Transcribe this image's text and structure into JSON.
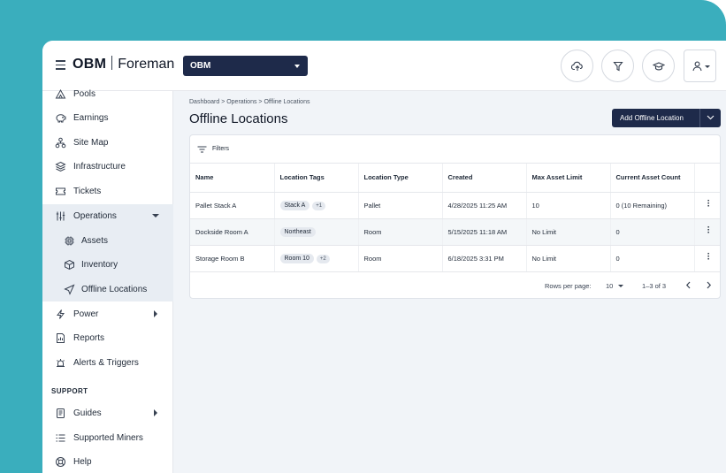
{
  "app": {
    "logo_bold": "OBM",
    "logo_text": "Foreman",
    "org_selector": "OBM"
  },
  "header_icons": [
    "upload-icon",
    "filter-icon",
    "graduation-cap-icon",
    "user-icon"
  ],
  "sidebar": {
    "items": [
      {
        "label": "Pools",
        "icon": "pools-icon"
      },
      {
        "label": "Earnings",
        "icon": "piggy-bank-icon"
      },
      {
        "label": "Site Map",
        "icon": "site-map-icon"
      },
      {
        "label": "Infrastructure",
        "icon": "layers-icon"
      },
      {
        "label": "Tickets",
        "icon": "ticket-icon"
      },
      {
        "label": "Operations",
        "icon": "sliders-icon"
      },
      {
        "label": "Assets",
        "icon": "chip-icon"
      },
      {
        "label": "Inventory",
        "icon": "box-icon"
      },
      {
        "label": "Offline Locations",
        "icon": "location-arrow-icon"
      },
      {
        "label": "Power",
        "icon": "lightning-icon"
      },
      {
        "label": "Reports",
        "icon": "report-icon"
      },
      {
        "label": "Alerts & Triggers",
        "icon": "alarm-icon"
      },
      {
        "label": "Guides",
        "icon": "book-icon"
      },
      {
        "label": "Supported Miners",
        "icon": "list-icon"
      },
      {
        "label": "Help",
        "icon": "lifebuoy-icon"
      }
    ],
    "section_support": "SUPPORT"
  },
  "main": {
    "breadcrumb": "Dashboard > Operations > Offline Locations",
    "title": "Offline Locations",
    "add_button": "Add Offline Location",
    "filters_label": "Filters",
    "columns": [
      "Name",
      "Location Tags",
      "Location Type",
      "Created",
      "Max Asset Limit",
      "Current Asset Count"
    ],
    "rows": [
      {
        "name": "Pallet Stack A",
        "tag": "Stack A",
        "extra": "+1",
        "type": "Pallet",
        "created": "4/28/2025 11:25 AM",
        "max": "10",
        "count": "0 (10 Remaining)"
      },
      {
        "name": "Dockside Room A",
        "tag": "Northeast",
        "extra": "",
        "type": "Room",
        "created": "5/15/2025 11:18 AM",
        "max": "No Limit",
        "count": "0"
      },
      {
        "name": "Storage Room B",
        "tag": "Room 10",
        "extra": "+2",
        "type": "Room",
        "created": "6/18/2025 3:31 PM",
        "max": "No Limit",
        "count": "0"
      }
    ],
    "pager": {
      "rows_per_page_label": "Rows per page:",
      "rows_per_page": "10",
      "range": "1–3 of 3"
    }
  },
  "colors": {
    "background": "#3aaebd",
    "navy": "#1e2a4a",
    "selected_group": "#e8edf3"
  }
}
